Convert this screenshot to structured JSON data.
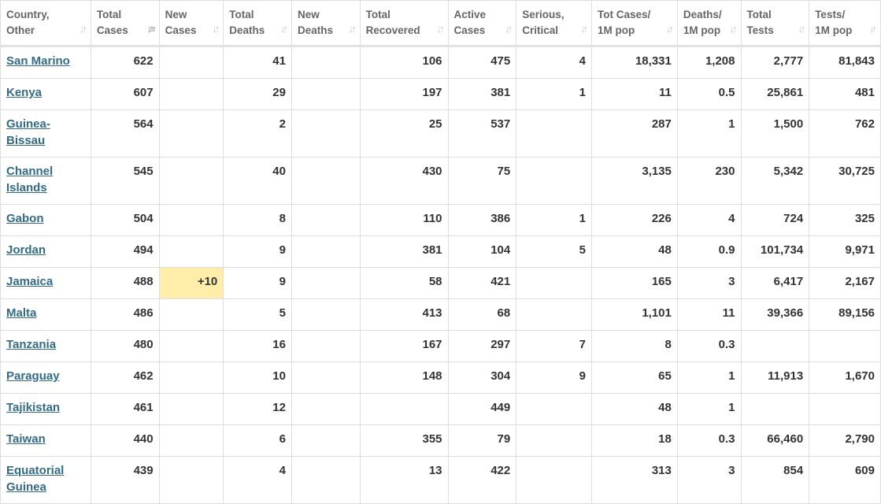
{
  "columns": [
    {
      "line1": "Country,",
      "line2": "Other",
      "key": "country"
    },
    {
      "line1": "Total",
      "line2": "Cases",
      "key": "total_cases"
    },
    {
      "line1": "New",
      "line2": "Cases",
      "key": "new_cases"
    },
    {
      "line1": "Total",
      "line2": "Deaths",
      "key": "total_deaths"
    },
    {
      "line1": "New",
      "line2": "Deaths",
      "key": "new_deaths"
    },
    {
      "line1": "Total",
      "line2": "Recovered",
      "key": "total_recovered"
    },
    {
      "line1": "Active",
      "line2": "Cases",
      "key": "active_cases"
    },
    {
      "line1": "Serious,",
      "line2": "Critical",
      "key": "serious_critical"
    },
    {
      "line1": "Tot Cases/",
      "line2": "1M pop",
      "key": "tot_cases_1m"
    },
    {
      "line1": "Deaths/",
      "line2": "1M pop",
      "key": "deaths_1m"
    },
    {
      "line1": "Total",
      "line2": "Tests",
      "key": "total_tests"
    },
    {
      "line1": "Tests/",
      "line2": "1M pop",
      "key": "tests_1m"
    }
  ],
  "sort": {
    "column": "total_cases",
    "direction": "desc"
  },
  "highlight_color": "#ffeeaa",
  "link_color": "#336b87",
  "rows": [
    {
      "country": "San Marino",
      "total_cases": "622",
      "new_cases": "",
      "total_deaths": "41",
      "new_deaths": "",
      "total_recovered": "106",
      "active_cases": "475",
      "serious_critical": "4",
      "tot_cases_1m": "18,331",
      "deaths_1m": "1,208",
      "total_tests": "2,777",
      "tests_1m": "81,843"
    },
    {
      "country": "Kenya",
      "total_cases": "607",
      "new_cases": "",
      "total_deaths": "29",
      "new_deaths": "",
      "total_recovered": "197",
      "active_cases": "381",
      "serious_critical": "1",
      "tot_cases_1m": "11",
      "deaths_1m": "0.5",
      "total_tests": "25,861",
      "tests_1m": "481"
    },
    {
      "country": "Guinea-Bissau",
      "total_cases": "564",
      "new_cases": "",
      "total_deaths": "2",
      "new_deaths": "",
      "total_recovered": "25",
      "active_cases": "537",
      "serious_critical": "",
      "tot_cases_1m": "287",
      "deaths_1m": "1",
      "total_tests": "1,500",
      "tests_1m": "762"
    },
    {
      "country": "Channel Islands",
      "total_cases": "545",
      "new_cases": "",
      "total_deaths": "40",
      "new_deaths": "",
      "total_recovered": "430",
      "active_cases": "75",
      "serious_critical": "",
      "tot_cases_1m": "3,135",
      "deaths_1m": "230",
      "total_tests": "5,342",
      "tests_1m": "30,725"
    },
    {
      "country": "Gabon",
      "total_cases": "504",
      "new_cases": "",
      "total_deaths": "8",
      "new_deaths": "",
      "total_recovered": "110",
      "active_cases": "386",
      "serious_critical": "1",
      "tot_cases_1m": "226",
      "deaths_1m": "4",
      "total_tests": "724",
      "tests_1m": "325"
    },
    {
      "country": "Jordan",
      "total_cases": "494",
      "new_cases": "",
      "total_deaths": "9",
      "new_deaths": "",
      "total_recovered": "381",
      "active_cases": "104",
      "serious_critical": "5",
      "tot_cases_1m": "48",
      "deaths_1m": "0.9",
      "total_tests": "101,734",
      "tests_1m": "9,971"
    },
    {
      "country": "Jamaica",
      "total_cases": "488",
      "new_cases": "+10",
      "total_deaths": "9",
      "new_deaths": "",
      "total_recovered": "58",
      "active_cases": "421",
      "serious_critical": "",
      "tot_cases_1m": "165",
      "deaths_1m": "3",
      "total_tests": "6,417",
      "tests_1m": "2,167"
    },
    {
      "country": "Malta",
      "total_cases": "486",
      "new_cases": "",
      "total_deaths": "5",
      "new_deaths": "",
      "total_recovered": "413",
      "active_cases": "68",
      "serious_critical": "",
      "tot_cases_1m": "1,101",
      "deaths_1m": "11",
      "total_tests": "39,366",
      "tests_1m": "89,156"
    },
    {
      "country": "Tanzania",
      "total_cases": "480",
      "new_cases": "",
      "total_deaths": "16",
      "new_deaths": "",
      "total_recovered": "167",
      "active_cases": "297",
      "serious_critical": "7",
      "tot_cases_1m": "8",
      "deaths_1m": "0.3",
      "total_tests": "",
      "tests_1m": ""
    },
    {
      "country": "Paraguay",
      "total_cases": "462",
      "new_cases": "",
      "total_deaths": "10",
      "new_deaths": "",
      "total_recovered": "148",
      "active_cases": "304",
      "serious_critical": "9",
      "tot_cases_1m": "65",
      "deaths_1m": "1",
      "total_tests": "11,913",
      "tests_1m": "1,670"
    },
    {
      "country": "Tajikistan",
      "total_cases": "461",
      "new_cases": "",
      "total_deaths": "12",
      "new_deaths": "",
      "total_recovered": "",
      "active_cases": "449",
      "serious_critical": "",
      "tot_cases_1m": "48",
      "deaths_1m": "1",
      "total_tests": "",
      "tests_1m": ""
    },
    {
      "country": "Taiwan",
      "total_cases": "440",
      "new_cases": "",
      "total_deaths": "6",
      "new_deaths": "",
      "total_recovered": "355",
      "active_cases": "79",
      "serious_critical": "",
      "tot_cases_1m": "18",
      "deaths_1m": "0.3",
      "total_tests": "66,460",
      "tests_1m": "2,790"
    },
    {
      "country": "Equatorial Guinea",
      "total_cases": "439",
      "new_cases": "",
      "total_deaths": "4",
      "new_deaths": "",
      "total_recovered": "13",
      "active_cases": "422",
      "serious_critical": "",
      "tot_cases_1m": "313",
      "deaths_1m": "3",
      "total_tests": "854",
      "tests_1m": "609"
    }
  ]
}
